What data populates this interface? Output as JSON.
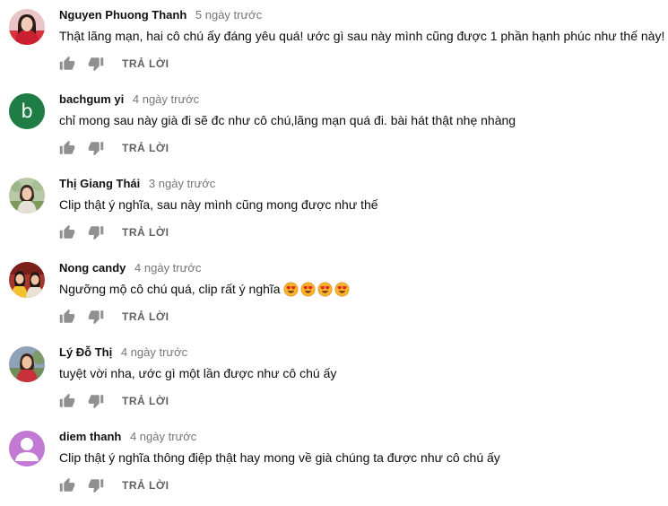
{
  "actions": {
    "reply_label": "TRẢ LỜI"
  },
  "colors": {
    "author_text": "#111111",
    "time_text": "#767676",
    "reply_text": "#606060",
    "icon": "#909090",
    "avatar_bachgum": "#1f7c44",
    "avatar_diem": "#c279d4"
  },
  "comments": [
    {
      "author": "Nguyen Phuong Thanh",
      "time": "5 ngày trước",
      "text": "Thật lãng mạn, hai cô chú ấy đáng yêu quá! ước gì sau này mình cũng được 1 phần hạnh phúc như thế này!",
      "avatar": "photo-woman-red"
    },
    {
      "author": "bachgum yi",
      "time": "4 ngày trước",
      "text": "chỉ mong sau này già đi sẽ đc như cô chú,lãng mạn quá đi. bài hát thật nhẹ nhàng",
      "avatar": "letter",
      "avatar_letter": "b"
    },
    {
      "author": "Thị Giang Thái",
      "time": "3 ngày trước",
      "text": "Clip thật ý nghĩa, sau này mình cũng mong được như thế",
      "avatar": "photo-outdoor"
    },
    {
      "author": "Nong candy",
      "time": "4 ngày trước",
      "text": "Ngưỡng mộ cô chú quá, clip rất ý nghĩa",
      "avatar": "photo-couple",
      "emoji": [
        "heart-eyes-emoji",
        "heart-eyes-emoji",
        "heart-eyes-emoji",
        "heart-eyes-emoji"
      ]
    },
    {
      "author": "Lý Đỗ Thị",
      "time": "4 ngày trước",
      "text": "tuyệt vời nha, ước gì một lần được như cô chú ấy",
      "avatar": "photo-woman-outdoor"
    },
    {
      "author": "diem thanh",
      "time": "4 ngày trước",
      "text": "Clip thật ý nghĩa thông điệp thật hay mong về già chúng ta được như cô chú ấy",
      "avatar": "default-profile"
    }
  ]
}
